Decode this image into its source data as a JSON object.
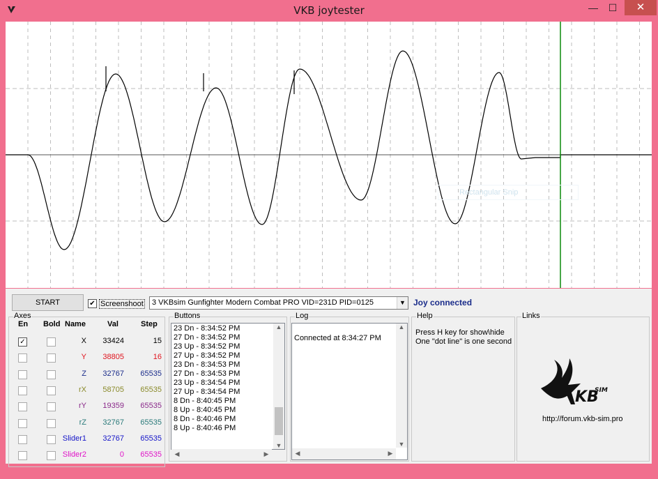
{
  "window": {
    "title": "VKB joytester",
    "icon": "vkb-app-icon",
    "minimize": "—",
    "maximize": "☐",
    "close": "✕"
  },
  "plot": {
    "snip_overlay": "Rectangular Snip",
    "colors": {
      "trace": "#000000",
      "grid": "#bdbdbd",
      "cursor": "#0a8a0a"
    }
  },
  "controls": {
    "start_label": "START",
    "screenshoot_label": "Screenshoot",
    "screenshoot_checked": true,
    "device": "3 VKBsim Gunfighter Modern Combat PRO  VID=231D PID=0125",
    "status": "Joy connected"
  },
  "axes": {
    "title": "Axes",
    "headers": {
      "en": "En",
      "bold": "Bold",
      "name": "Name",
      "val": "Val",
      "step": "Step"
    },
    "rows": [
      {
        "en": "✓",
        "bold": "",
        "name": "X",
        "val": "33424",
        "step": "15",
        "color": "#000000"
      },
      {
        "en": "",
        "bold": "",
        "name": "Y",
        "val": "38805",
        "step": "16",
        "color": "#e0141e"
      },
      {
        "en": "",
        "bold": "",
        "name": "Z",
        "val": "32767",
        "step": "65535",
        "color": "#1a2c8a"
      },
      {
        "en": "",
        "bold": "",
        "name": "rX",
        "val": "58705",
        "step": "65535",
        "color": "#8a8a2a"
      },
      {
        "en": "",
        "bold": "",
        "name": "rY",
        "val": "19359",
        "step": "65535",
        "color": "#8a2a8a"
      },
      {
        "en": "",
        "bold": "",
        "name": "rZ",
        "val": "32767",
        "step": "65535",
        "color": "#2a7a7a"
      },
      {
        "en": "",
        "bold": "",
        "name": "Slider1",
        "val": "32767",
        "step": "65535",
        "color": "#1414c8"
      },
      {
        "en": "",
        "bold": "",
        "name": "Slider2",
        "val": "0",
        "step": "65535",
        "color": "#e014c8"
      }
    ]
  },
  "buttons": {
    "title": "Buttons",
    "lines": [
      "23 Dn - 8:34:52 PM",
      "27 Dn - 8:34:52 PM",
      "23 Up - 8:34:52 PM",
      "27 Up - 8:34:52 PM",
      "23 Dn - 8:34:53 PM",
      "27 Dn - 8:34:53 PM",
      "23 Up - 8:34:54 PM",
      "27 Up - 8:34:54 PM",
      "8 Dn - 8:40:45 PM",
      "8 Up - 8:40:45 PM",
      "8 Dn - 8:40:46 PM",
      "8 Up - 8:40:46 PM"
    ]
  },
  "log": {
    "title": "Log",
    "lines": [
      "Connected at 8:34:27 PM"
    ]
  },
  "help": {
    "title": "Help",
    "line1": "Press H key for show\\hide",
    "line2": "One \"dot line\" is one second"
  },
  "links": {
    "title": "Links",
    "logo_text": "KB",
    "logo_sup": "SIM",
    "url": "http://forum.vkb-sim.pro"
  }
}
